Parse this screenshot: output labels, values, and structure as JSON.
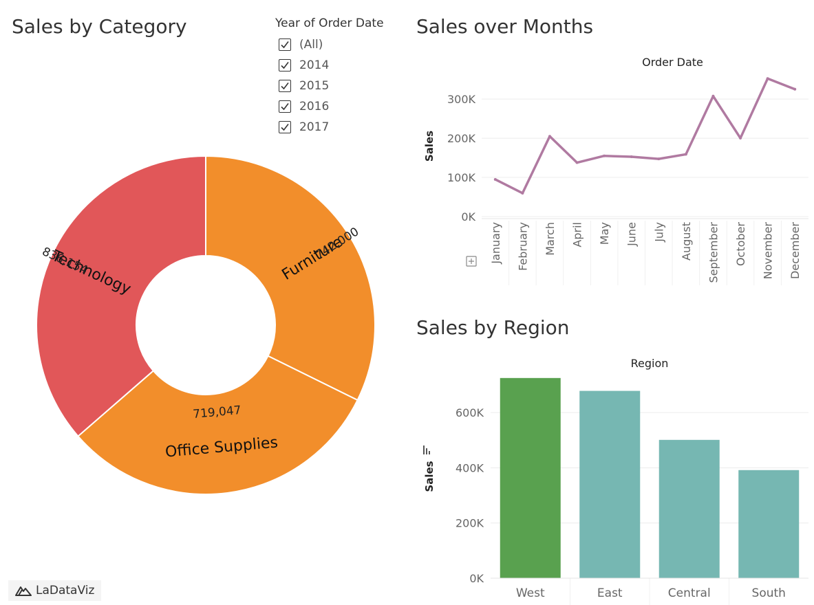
{
  "titles": {
    "category": "Sales by Category",
    "months": "Sales over Months",
    "region": "Sales by Region"
  },
  "filter": {
    "title": "Year of Order Date",
    "items": [
      {
        "label": "(All)",
        "checked": true
      },
      {
        "label": "2014",
        "checked": true
      },
      {
        "label": "2015",
        "checked": true
      },
      {
        "label": "2016",
        "checked": true
      },
      {
        "label": "2017",
        "checked": true
      }
    ]
  },
  "logo": {
    "text": "LaDataViz",
    "icon": "mountain-logo-icon"
  },
  "colors": {
    "technology": "#e15759",
    "furniture": "#f28e2b",
    "office_supplies": "#f28e2b",
    "line": "#b07aa1",
    "west": "#59a14f",
    "other_regions": "#76b7b2",
    "grid": "#ececec",
    "text": "#333333",
    "axis_text": "#666666"
  },
  "chart_data": [
    {
      "type": "pie",
      "variant": "donut",
      "slices": [
        {
          "name": "Furniture",
          "value": 742000,
          "label": "742,000"
        },
        {
          "name": "Office Supplies",
          "value": 719047,
          "label": "719,047"
        },
        {
          "name": "Technology",
          "value": 836154,
          "label": "836,154"
        }
      ]
    },
    {
      "type": "line",
      "title": "Order Date",
      "ylabel": "Sales",
      "categories": [
        "January",
        "February",
        "March",
        "April",
        "May",
        "June",
        "July",
        "August",
        "September",
        "October",
        "November",
        "December"
      ],
      "values": [
        94925,
        59751,
        205005,
        137762,
        155028,
        152718,
        147238,
        159044,
        307650,
        200323,
        352461,
        325294
      ],
      "ylim": [
        0,
        360000
      ],
      "yticks": [
        0,
        100000,
        200000,
        300000
      ],
      "ytick_labels": [
        "0K",
        "100K",
        "200K",
        "300K"
      ],
      "grid": true
    },
    {
      "type": "bar",
      "title": "Region",
      "ylabel": "Sales",
      "categories": [
        "West",
        "East",
        "Central",
        "South"
      ],
      "values": [
        725458,
        678781,
        501240,
        391722
      ],
      "ylim": [
        0,
        730000
      ],
      "yticks": [
        0,
        200000,
        400000,
        600000
      ],
      "ytick_labels": [
        "0K",
        "200K",
        "400K",
        "600K"
      ],
      "grid": true
    }
  ]
}
